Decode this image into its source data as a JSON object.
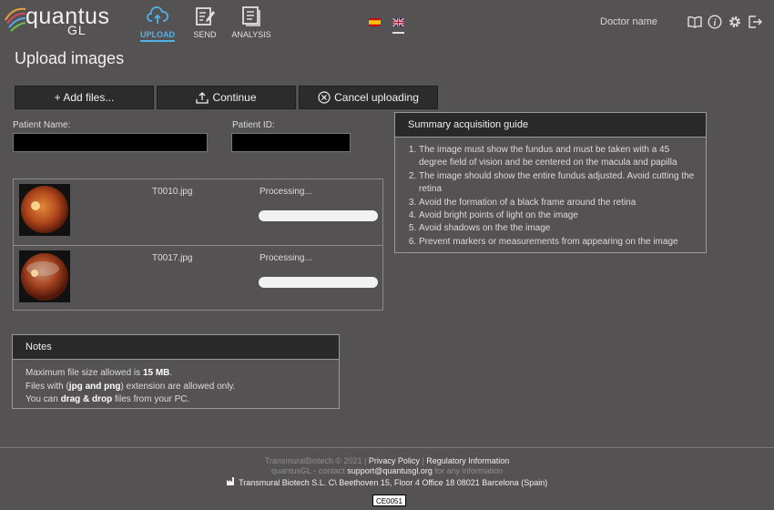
{
  "header": {
    "logo_text": "quantus",
    "logo_sub": "GL",
    "nav": [
      {
        "label": "UPLOAD",
        "icon": "cloud-upload-icon",
        "active": true
      },
      {
        "label": "SEND",
        "icon": "edit-document-icon",
        "active": false
      },
      {
        "label": "ANALYSIS",
        "icon": "document-list-icon",
        "active": false
      }
    ],
    "languages": [
      "es",
      "en"
    ],
    "doctor_name": "Doctor name",
    "icons": [
      "book-icon",
      "info-icon",
      "gear-icon",
      "logout-icon"
    ]
  },
  "page_title": "Upload images",
  "toolbar": {
    "add_files": "+ Add files...",
    "continue": "Continue",
    "cancel": "Cancel uploading"
  },
  "patient": {
    "name_label": "Patient Name:",
    "name_value": "",
    "id_label": "Patient ID:",
    "id_value": ""
  },
  "files": [
    {
      "name": "T0010.jpg",
      "status": "Processing..."
    },
    {
      "name": "T0017.jpg",
      "status": "Processing..."
    }
  ],
  "guide": {
    "title": "Summary acquisition guide",
    "items": [
      "The image must show the fundus and must be taken with a 45 degree field of vision and be centered on the macula and papilla",
      "The image should show the entire fundus adjusted. Avoid cutting the retina",
      "Avoid the formation of a black frame around the retina",
      "Avoid bright points of light on the image",
      "Avoid shadows on the the image",
      "Prevent markers or measurements from appearing on the image"
    ]
  },
  "notes": {
    "title": "Notes",
    "line1_pre": "Maximum file size allowed is ",
    "line1_bold": "15 MB",
    "line1_post": ".",
    "line2_pre": "Files with (",
    "line2_bold": "jpg and png",
    "line2_post": ") extension are allowed only.",
    "line3_pre": "You can ",
    "line3_bold": "drag & drop",
    "line3_post": " files from your PC."
  },
  "footer": {
    "copyright": "TransmuralBiotech © 2021 |",
    "privacy": "Privacy Policy",
    "sep": "|",
    "regulatory": "Regulatory Information",
    "contact_pre": "quantusGL - contact",
    "email": "support@quantusgl.org",
    "contact_post": "for any information",
    "address": "Transmural Biotech S.L. C\\ Beethoven 15, Floor 4 Office 18 08021 Barcelona (Spain)",
    "ce_mark": "CE0051"
  },
  "colors": {
    "background": "#545252",
    "accent": "#4fb3e8",
    "button": "#2d2c2c"
  }
}
